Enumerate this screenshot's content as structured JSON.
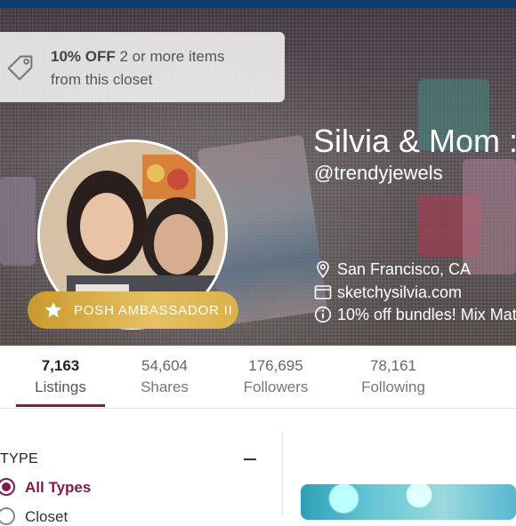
{
  "promo": {
    "highlight": "10% OFF",
    "text_line1": " 2 or more items",
    "text_line2": "from this closet"
  },
  "profile": {
    "name": "Silvia & Mom :)",
    "handle": "@trendyjewels",
    "location": "San Francisco, CA",
    "website": "sketchysilvia.com",
    "note": "10% off bundles! Mix Mat",
    "badge": "POSH AMBASSADOR II"
  },
  "stats": [
    {
      "value": "7,163",
      "label": "Listings",
      "active": true
    },
    {
      "value": "54,604",
      "label": "Shares",
      "active": false
    },
    {
      "value": "176,695",
      "label": "Followers",
      "active": false
    },
    {
      "value": "78,161",
      "label": "Following",
      "active": false
    }
  ],
  "filters": {
    "title": "TYPE",
    "options": [
      {
        "label": "All Types",
        "selected": true
      },
      {
        "label": "Closet",
        "selected": false
      }
    ]
  },
  "colors": {
    "accent": "#7d1b4e",
    "badge_gold": "#d9b04a",
    "top_bar": "#0f3d6b"
  },
  "icons": [
    "tag-icon",
    "star-icon",
    "location-pin-icon",
    "website-icon",
    "info-icon",
    "collapse-icon"
  ]
}
